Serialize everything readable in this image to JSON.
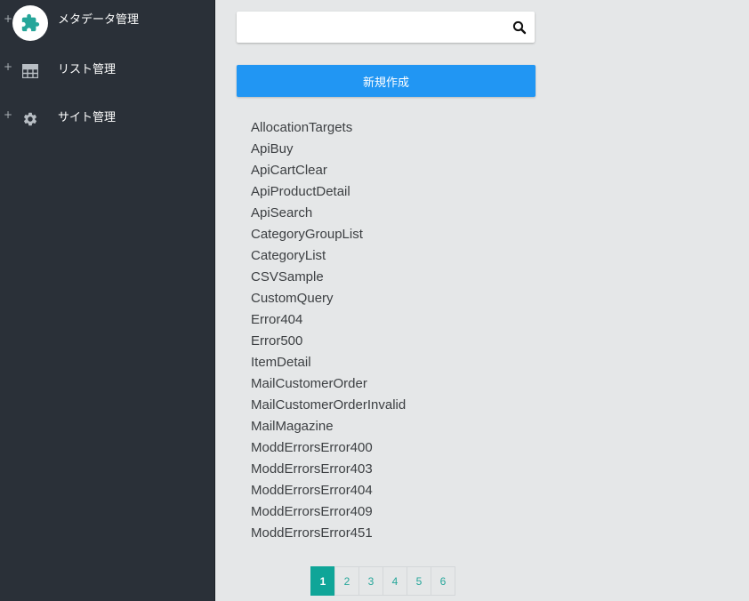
{
  "sidebar": {
    "items": [
      {
        "expand": "+",
        "label": "メタデータ管理",
        "icon": "puzzle-icon",
        "active": true
      },
      {
        "expand": "+",
        "label": "リスト管理",
        "icon": "table-icon",
        "active": false
      },
      {
        "expand": "+",
        "label": "サイト管理",
        "icon": "gear-icon",
        "active": false
      }
    ]
  },
  "search": {
    "value": "",
    "placeholder": "",
    "icon": "search-icon"
  },
  "create_button": {
    "label": "新規作成"
  },
  "items": [
    "AllocationTargets",
    "ApiBuy",
    "ApiCartClear",
    "ApiProductDetail",
    "ApiSearch",
    "CategoryGroupList",
    "CategoryList",
    "CSVSample",
    "CustomQuery",
    "Error404",
    "Error500",
    "ItemDetail",
    "MailCustomerOrder",
    "MailCustomerOrderInvalid",
    "MailMagazine",
    "ModdErrorsError400",
    "ModdErrorsError403",
    "ModdErrorsError404",
    "ModdErrorsError409",
    "ModdErrorsError451"
  ],
  "pagination": {
    "pages": [
      "1",
      "2",
      "3",
      "4",
      "5",
      "6"
    ],
    "current": "1"
  },
  "colors": {
    "sidebar_bg": "#2a3038",
    "main_bg": "#e5e7e8",
    "primary_button": "#2196f3",
    "active_accent": "#0fa598",
    "puzzle_icon": "#26a69a"
  }
}
